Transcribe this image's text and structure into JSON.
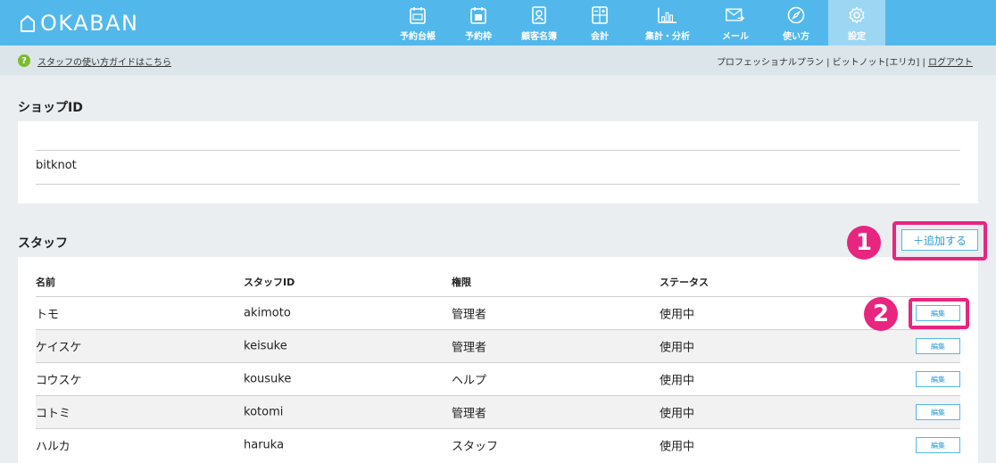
{
  "app": {
    "logo_text": "OKABAN"
  },
  "nav": [
    {
      "label": "予約台帳",
      "icon": "calendar-icon"
    },
    {
      "label": "予約枠",
      "icon": "calendar-grid-icon"
    },
    {
      "label": "顧客名簿",
      "icon": "address-book-icon"
    },
    {
      "label": "会計",
      "icon": "calculator-icon"
    },
    {
      "label": "集計・分析",
      "icon": "bar-chart-icon"
    },
    {
      "label": "メール",
      "icon": "mail-icon"
    },
    {
      "label": "使い方",
      "icon": "compass-icon"
    },
    {
      "label": "設定",
      "icon": "gear-icon",
      "active": true
    }
  ],
  "subbar": {
    "help_icon": "?",
    "guide_link": "スタッフの使い方ガイドはこちら",
    "account_text": "プロフェッショナルプラン | ビットノット[エリカ] | ",
    "logout": "ログアウト"
  },
  "shop": {
    "title": "ショップID",
    "id": "bitknot"
  },
  "staff": {
    "title": "スタッフ",
    "add_button": "＋追加する",
    "columns": [
      "名前",
      "スタッフID",
      "権限",
      "ステータス"
    ],
    "edit_label": "編集",
    "rows": [
      {
        "name": "トモ",
        "staff_id": "akimoto",
        "role": "管理者",
        "status": "使用中"
      },
      {
        "name": "ケイスケ",
        "staff_id": "keisuke",
        "role": "管理者",
        "status": "使用中"
      },
      {
        "name": "コウスケ",
        "staff_id": "kousuke",
        "role": "ヘルプ",
        "status": "使用中"
      },
      {
        "name": "コトミ",
        "staff_id": "kotomi",
        "role": "管理者",
        "status": "使用中"
      },
      {
        "name": "ハルカ",
        "staff_id": "haruka",
        "role": "スタッフ",
        "status": "使用中"
      }
    ]
  },
  "annotations": {
    "marker_1": "1",
    "marker_2": "2"
  },
  "colors": {
    "header": "#52b8ec",
    "active_tab": "#9dd6f3",
    "highlight": "#e8257f",
    "help_badge": "#7dba2c"
  }
}
